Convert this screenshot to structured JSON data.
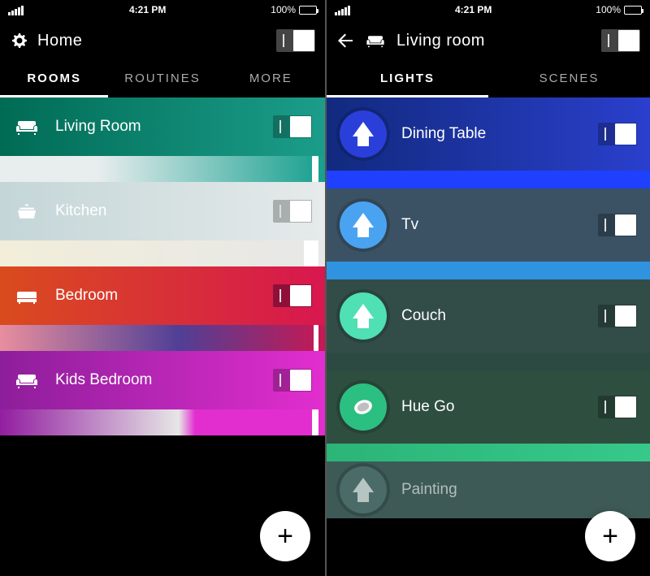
{
  "status": {
    "time": "4:21 PM",
    "battery_pct": "100%"
  },
  "left": {
    "header_title": "Home",
    "tabs": [
      "ROOMS",
      "ROUTINES",
      "MORE"
    ],
    "active_tab": 0,
    "rooms": [
      {
        "name": "Living Room",
        "icon": "sofa",
        "thumb_width": 8
      },
      {
        "name": "Kitchen",
        "icon": "pot",
        "thumb_width": 18
      },
      {
        "name": "Bedroom",
        "icon": "bed",
        "thumb_width": 6
      },
      {
        "name": "Kids Bedroom",
        "icon": "sofa",
        "thumb_width": 8
      }
    ],
    "fab": "+"
  },
  "right": {
    "header_title": "Living room",
    "tabs": [
      "LIGHTS",
      "SCENES"
    ],
    "active_tab": 0,
    "lights": [
      {
        "name": "Dining Table",
        "icon": "bulb"
      },
      {
        "name": "Tv",
        "icon": "bulb"
      },
      {
        "name": "Couch",
        "icon": "bulb"
      },
      {
        "name": "Hue Go",
        "icon": "disc"
      },
      {
        "name": "Painting",
        "icon": "bulb"
      }
    ],
    "fab": "+"
  }
}
